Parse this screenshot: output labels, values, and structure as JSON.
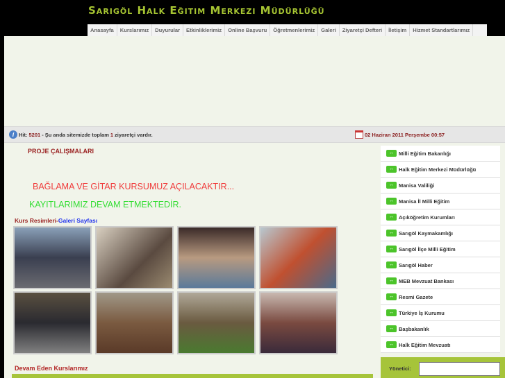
{
  "header": {
    "title": "Sarıgöl Halk Eğitim Merkezi Müdürlüğü"
  },
  "nav": [
    "Anasayfa",
    "Kurslarımız",
    "Duyurular",
    "Etkinliklerimiz",
    "Online Başvuru",
    "Öğretmenlerimiz",
    "Galeri",
    "Ziyaretçi Defteri",
    "İletişim",
    "Hizmet Standartlarımız"
  ],
  "status": {
    "hit_label": "Hit:",
    "hit_value": "5201",
    "text1": "- Şu anda sitemizde toplam",
    "visitors": "1",
    "text2": "ziyaretçi vardır.",
    "date": "02 Haziran 2011 Perşembe 00:57"
  },
  "content": {
    "project_title": "PROJE ÇALIŞMALARI",
    "announcement1": "BAĞLAMA VE GİTAR KURSUMUZ AÇILACAKTIR...",
    "announcement2": "KAYITLARIMIZ DEVAM ETMEKTEDİR.",
    "gallery_label": "Kurs Resimleri-",
    "gallery_link": "Galeri Sayfası",
    "ongoing_title": "Devam Eden Kurslarımız"
  },
  "sidebar": [
    "Milli Eğitim Bakanlığı",
    "Halk Eğitim Merkezi Müdürlüğü",
    "Manisa Valiliği",
    "Manisa İl Milli Eğitim",
    "Açıköğretim Kurumları",
    "Sarıgöl Kaymakamlığı",
    "Sarıgöl İlçe Milli Eğitim",
    "Sarıgöl Haber",
    "MEB Mevzuat Bankası",
    "Resmi Gazete",
    "Türkiye İş Kurumu",
    "Başbakanlık",
    "Halk Eğitim Mevzuatı"
  ],
  "login": {
    "label": "Yönetici:"
  }
}
